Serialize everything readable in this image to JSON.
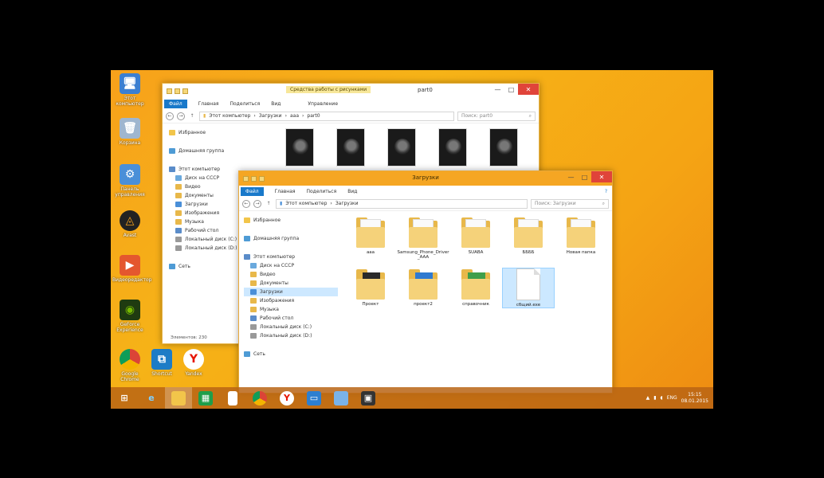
{
  "desktop_icons": [
    {
      "label": "Этот компьютер",
      "icon": "computer-icon"
    },
    {
      "label": "Корзина",
      "icon": "recycle-bin-icon"
    },
    {
      "label": "Панель управления",
      "icon": "control-panel-icon"
    },
    {
      "label": "Avast",
      "icon": "avast-icon"
    },
    {
      "label": "Видеоредактор",
      "icon": "video-icon"
    },
    {
      "label": "GeForce Experience",
      "icon": "nvidia-icon"
    },
    {
      "label": "Google Chrome",
      "icon": "chrome-icon"
    },
    {
      "label": "Shortcut",
      "icon": "shortcut-icon"
    },
    {
      "label": "Yandex",
      "icon": "yandex-icon"
    }
  ],
  "back_window": {
    "title": "part0",
    "context_tab": "Средства работы с рисунками",
    "ribbon_tabs": [
      "Файл",
      "Главная",
      "Поделиться",
      "Вид",
      "Управление"
    ],
    "path": [
      "Этот компьютер",
      "Загрузки",
      "ааа",
      "part0"
    ],
    "search_placeholder": "Поиск: part0",
    "nav": [
      "Избранное",
      "Домашняя группа",
      "Этот компьютер",
      "Диск на СССР",
      "Видео",
      "Документы",
      "Загрузки",
      "Изображения",
      "Музыка",
      "Рабочий стол",
      "Локальный диск (C:)",
      "Локальный диск (D:)",
      "Сеть"
    ],
    "files_count": 5,
    "status": "Элементов: 230"
  },
  "front_window": {
    "title": "Загрузки",
    "ribbon_tabs": [
      "Файл",
      "Главная",
      "Поделиться",
      "Вид"
    ],
    "path": [
      "Этот компьютер",
      "Загрузки"
    ],
    "search_placeholder": "Поиск: Загрузки",
    "nav": [
      {
        "label": "Избранное",
        "icon": "star-icon",
        "indent": 0
      },
      {
        "label": "Домашняя группа",
        "icon": "homegroup-icon",
        "indent": 0
      },
      {
        "label": "Этот компьютер",
        "icon": "computer-icon",
        "indent": 0
      },
      {
        "label": "Диск на СССР",
        "icon": "drive-icon",
        "indent": 1
      },
      {
        "label": "Видео",
        "icon": "video-folder-icon",
        "indent": 1
      },
      {
        "label": "Документы",
        "icon": "documents-icon",
        "indent": 1
      },
      {
        "label": "Загрузки",
        "icon": "downloads-icon",
        "indent": 1,
        "selected": true
      },
      {
        "label": "Изображения",
        "icon": "pictures-icon",
        "indent": 1
      },
      {
        "label": "Музыка",
        "icon": "music-icon",
        "indent": 1
      },
      {
        "label": "Рабочий стол",
        "icon": "desktop-icon",
        "indent": 1
      },
      {
        "label": "Локальный диск (C:)",
        "icon": "disk-icon",
        "indent": 1
      },
      {
        "label": "Локальный диск (D:)",
        "icon": "disk-icon",
        "indent": 1
      },
      {
        "label": "Сеть",
        "icon": "network-icon",
        "indent": 0
      }
    ],
    "files": [
      {
        "name": "ааа",
        "kind": "folder-papers"
      },
      {
        "name": "Samsung_Phone_Driver_AAA",
        "kind": "folder-doc"
      },
      {
        "name": "SUABA",
        "kind": "folder-papers"
      },
      {
        "name": "ББББ",
        "kind": "folder-papers"
      },
      {
        "name": "Новая папка",
        "kind": "folder-papers"
      },
      {
        "name": "Проект",
        "kind": "folder-photo"
      },
      {
        "name": "проект2",
        "kind": "folder-blue"
      },
      {
        "name": "справочник",
        "kind": "folder-green"
      },
      {
        "name": "сбщий.exe",
        "kind": "blank",
        "selected": true
      }
    ]
  },
  "taskbar": {
    "items": [
      "start-icon",
      "ie-icon",
      "explorer-icon",
      "store-icon",
      "file-icon",
      "chrome-icon",
      "yandex-icon",
      "monitor-icon",
      "folder-icon",
      "app-icon"
    ],
    "language": "ENG",
    "time": "15:15",
    "date": "08.01.2015"
  }
}
